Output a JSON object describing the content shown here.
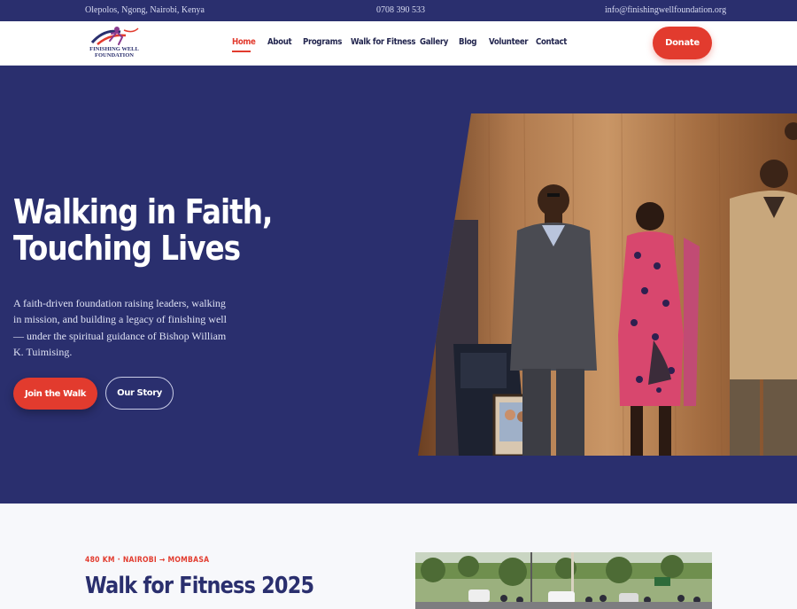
{
  "topbar": {
    "address": "Olepolos, Ngong, Nairobi, Kenya",
    "phone": "0708 390 533",
    "email": "info@finishingwellfoundation.org"
  },
  "logo": {
    "line1": "FINISHING WELL",
    "line2": "FOUNDATION"
  },
  "nav": {
    "items": [
      "Home",
      "About",
      "Programs",
      "Walk for Fitness",
      "Gallery",
      "Blog",
      "Volunteer",
      "Contact"
    ],
    "active": "Home",
    "donate_label": "Donate"
  },
  "hero": {
    "title_line1": "Walking in Faith,",
    "title_line2": "Touching Lives",
    "description": "A faith-driven foundation raising leaders, walking in mission, and building a legacy of finishing well — under the spiritual guidance of Bishop William K. Tuimising.",
    "primary_button": "Join the Walk",
    "secondary_button": "Our Story"
  },
  "section": {
    "eyebrow": "480 KM · NAIROBI → MOMBASA",
    "title": "Walk for Fitness 2025"
  },
  "colors": {
    "navy": "#2a2f6e",
    "accent_red": "#e23b2e",
    "page_bg": "#f7f8fb"
  }
}
